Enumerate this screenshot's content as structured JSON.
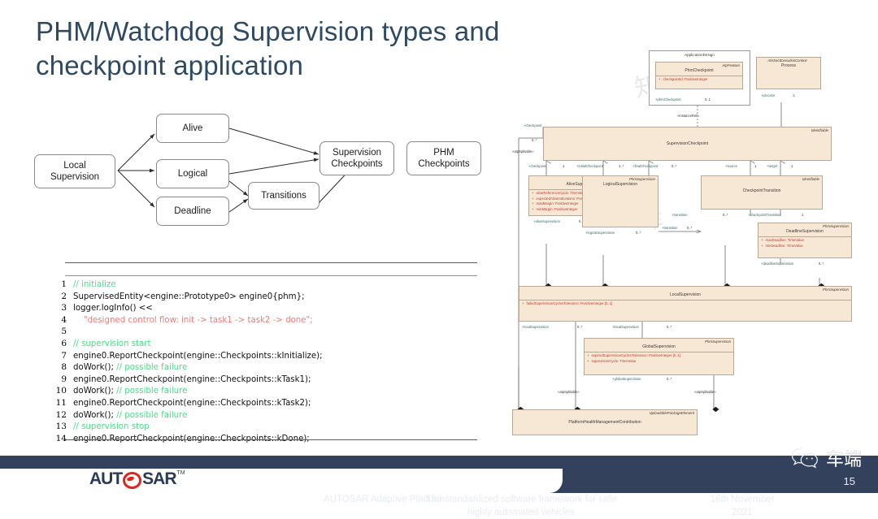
{
  "slide": {
    "title": "PHM/Watchdog Supervision types and checkpoint application",
    "page_number": "15"
  },
  "flow": {
    "nodes": [
      {
        "id": "local-supervision",
        "label": "Local\nSupervision"
      },
      {
        "id": "alive",
        "label": "Alive"
      },
      {
        "id": "logical",
        "label": "Logical"
      },
      {
        "id": "deadline",
        "label": "Deadline"
      },
      {
        "id": "transitions",
        "label": "Transitions"
      },
      {
        "id": "supervision-checkpoints",
        "label": "Supervision\nCheckpoints"
      },
      {
        "id": "phm-checkpoints",
        "label": "PHM\nCheckpoints"
      }
    ]
  },
  "code": {
    "lines": [
      {
        "n": "1",
        "segments": [
          {
            "t": "// initialize",
            "k": "cmt"
          }
        ]
      },
      {
        "n": "2",
        "segments": [
          {
            "t": "SupervisedEntity<engine::Prototype0> engine0{phm};",
            "k": "txt"
          }
        ]
      },
      {
        "n": "3",
        "segments": [
          {
            "t": "logger.logInfo() <<",
            "k": "txt"
          }
        ]
      },
      {
        "n": "4",
        "segments": [
          {
            "t": "    \"designed control flow: init -> task1 -> task2 -> done\";",
            "k": "str"
          }
        ]
      },
      {
        "n": "5",
        "segments": [
          {
            "t": "",
            "k": "txt"
          }
        ]
      },
      {
        "n": "6",
        "segments": [
          {
            "t": "// supervision start",
            "k": "cmt"
          }
        ]
      },
      {
        "n": "7",
        "segments": [
          {
            "t": "engine0.ReportCheckpoint(engine::Checkpoints::kInitialize);",
            "k": "txt"
          }
        ]
      },
      {
        "n": "8",
        "segments": [
          {
            "t": "doWork(); ",
            "k": "txt"
          },
          {
            "t": "// possible failure",
            "k": "cmt"
          }
        ]
      },
      {
        "n": "9",
        "segments": [
          {
            "t": "engine0.ReportCheckpoint(engine::Checkpoints::kTask1);",
            "k": "txt"
          }
        ]
      },
      {
        "n": "10",
        "segments": [
          {
            "t": "doWork(); ",
            "k": "txt"
          },
          {
            "t": "// possible failure",
            "k": "cmt"
          }
        ]
      },
      {
        "n": "11",
        "segments": [
          {
            "t": "engine0.ReportCheckpoint(engine::Checkpoints::kTask2);",
            "k": "txt"
          }
        ]
      },
      {
        "n": "12",
        "segments": [
          {
            "t": "doWork(); ",
            "k": "txt"
          },
          {
            "t": "// possible failure",
            "k": "cmt"
          }
        ]
      },
      {
        "n": "13",
        "segments": [
          {
            "t": "// supervision stop",
            "k": "cmt"
          }
        ]
      },
      {
        "n": "14",
        "segments": [
          {
            "t": "engine0.ReportCheckpoint(engine::Checkpoints::kDone);",
            "k": "txt"
          }
        ]
      }
    ]
  },
  "uml": {
    "package": {
      "name": "ApplicationDesign"
    },
    "classes": {
      "phm_checkpoint": {
        "stereotype": "AtpFeature",
        "name": "PhmCheckpoint",
        "attrs": [
          "checkpointId: PositiveInteger"
        ]
      },
      "process": {
        "stereotype": "AbstractExecutionContext",
        "name": "Process",
        "attrs": []
      },
      "supervision_checkpoint": {
        "stereotype": "Identifiable",
        "name": "SupervisionCheckpoint",
        "attrs": []
      },
      "alive_supervision": {
        "stereotype": "PhmSupervision",
        "name": "AliveSupervision",
        "attrs": [
          "aliveReferenceCycle: TimeValue",
          "expectedAliveIndications: PositiveInteger",
          "maxMargin: PositiveInteger",
          "minMargin: PositiveInteger"
        ]
      },
      "logical_supervision": {
        "stereotype": "PhmSupervision",
        "name": "LogicalSupervision",
        "attrs": []
      },
      "checkpoint_transition": {
        "stereotype": "Identifiable",
        "name": "CheckpointTransition",
        "attrs": []
      },
      "deadline_supervision": {
        "stereotype": "PhmSupervision",
        "name": "DeadlineSupervision",
        "attrs": [
          "maxDeadline: TimeValue",
          "minDeadline: TimeValue"
        ]
      },
      "local_supervision": {
        "stereotype": "PhmSupervision",
        "name": "LocalSupervision",
        "attrs": [
          "failedSupervisionCyclesTolerance: PositiveInteger [0..1]"
        ]
      },
      "global_supervision": {
        "stereotype": "PhmSupervision",
        "name": "GlobalSupervision",
        "attrs": [
          "expiredSupervisionCyclesTolerance: PositiveInteger [0..1]",
          "supervisionCycle: TimeValue"
        ]
      },
      "phm_contribution": {
        "stereotype": "UploadablePackageElement",
        "name": "PlatformHealthManagementContribution",
        "attrs": []
      }
    },
    "roles": {
      "phm_checkpoint_role": "+phmCheckpoint",
      "phm_checkpoint_mult": "0..1",
      "instance_ref": "«instanceRef»",
      "process_role": "+process",
      "process_mult": "1",
      "checkpoint_top_role": "+checkpoint",
      "checkpoint_top_mult": "0..*",
      "atp_splitable_left": "«atpSplitable»",
      "checkpoint_role": "+checkpoint",
      "checkpoint_mult": "1",
      "initial_checkpoint_role": "+initialCheckpoint",
      "initial_checkpoint_mult": "1..*",
      "final_checkpoint_role": "+finalCheckpoint",
      "final_checkpoint_mult": "0..*",
      "source_role": "+source",
      "source_mult": "1",
      "target_role": "+target",
      "target_mult": "1",
      "transition_role": "+transition",
      "transition_mult": "0..*",
      "transition_role2": "+transition",
      "transition_mult2": "0..*",
      "checkpoint_transition_role": "+checkpointTransition",
      "checkpoint_transition_mult": "1",
      "alive_supervision_role": "+aliveSupervision",
      "alive_supervision_mult": "0..*",
      "logical_supervision_role": "+logicalSupervision",
      "logical_supervision_mult": "0..*",
      "deadline_supervision_role": "+deadlineSupervision",
      "deadline_supervision_mult": "0..*",
      "local_supervision_role": "+localSupervision",
      "local_supervision_mult": "0..*",
      "local_supervision_role2": "+localSupervision",
      "local_supervision_mult2": "0..*",
      "global_supervision_role": "+globalSupervision",
      "global_supervision_mult": "0..*",
      "atp_splitable_a": "«atpSplitable»",
      "atp_splitable_b": "«atpSplitable»"
    }
  },
  "footer": {
    "logo_left": "AUT",
    "logo_right": "SAR",
    "logo_tm": "TM",
    "platform": "AUTOSAR Adaptive Platform",
    "tagline": "The standardized software framework for safe highly automated vehicles",
    "date": "16th November 2021"
  },
  "watermark": {
    "wechat_label": "车端"
  },
  "colors": {
    "title": "#2e4a63",
    "footer_bg": "#33415c",
    "uml_fill": "#f7e8d6",
    "uml_border": "#b8a894",
    "attr_text": "#c0392b",
    "role_text": "#2e6b6b",
    "code_comment": "#4ddc8a",
    "code_string": "#ef7b7b",
    "logo_red": "#e2231a"
  }
}
